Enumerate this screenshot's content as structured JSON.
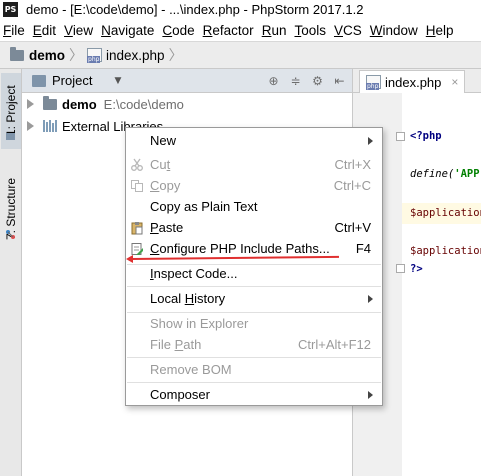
{
  "window": {
    "title": "demo - [E:\\code\\demo] - ...\\index.php - PhpStorm 2017.1.2",
    "logo_text": "PS"
  },
  "menubar": {
    "items": [
      {
        "ul": "F",
        "rest": "ile"
      },
      {
        "ul": "E",
        "rest": "dit"
      },
      {
        "ul": "V",
        "rest": "iew"
      },
      {
        "ul": "N",
        "rest": "avigate"
      },
      {
        "ul": "C",
        "rest": "ode"
      },
      {
        "ul": "R",
        "rest": "efactor"
      },
      {
        "ul": "R",
        "rest": "un"
      },
      {
        "ul": "T",
        "rest": "ools"
      },
      {
        "ul": "V",
        "rest": "CS"
      },
      {
        "ul": "W",
        "rest": "indow"
      },
      {
        "ul": "H",
        "rest": "elp"
      }
    ]
  },
  "navbar": {
    "project": "demo",
    "file": "index.php"
  },
  "toolstrip": {
    "project_tab": "1: Project",
    "structure_tab": "7: Structure"
  },
  "project_panel": {
    "title": "Project",
    "tree": [
      {
        "name": "demo",
        "path": "E:\\code\\demo"
      },
      {
        "name": "External Libraries"
      }
    ]
  },
  "editor": {
    "tab_label": "index.php",
    "close_glyph": "×",
    "lines": [
      {
        "text": "<?php"
      },
      {
        "func": "define(",
        "str": "'APP'"
      },
      {
        "var": "$application"
      },
      {
        "var": "$application"
      },
      {
        "text": "?>"
      }
    ]
  },
  "context_menu": {
    "items": [
      {
        "label_ul": "",
        "label_pre": "New",
        "label_rest": "",
        "shortcut": "",
        "submenu": true,
        "enabled": true
      },
      {
        "label_pre": "Cu",
        "label_ul": "t",
        "label_rest": "",
        "shortcut": "Ctrl+X",
        "enabled": false
      },
      {
        "label_pre": "",
        "label_ul": "C",
        "label_rest": "opy",
        "shortcut": "Ctrl+C",
        "enabled": false
      },
      {
        "label_pre": "Copy as Plain Text",
        "label_ul": "",
        "label_rest": "",
        "shortcut": "",
        "enabled": true
      },
      {
        "label_pre": "",
        "label_ul": "P",
        "label_rest": "aste",
        "shortcut": "Ctrl+V",
        "enabled": true
      },
      {
        "label_pre": "",
        "label_ul": "C",
        "label_rest": "onfigure PHP Include Paths...",
        "shortcut": "F4",
        "enabled": true
      },
      {
        "label_pre": "",
        "label_ul": "I",
        "label_rest": "nspect Code...",
        "shortcut": "",
        "enabled": true
      },
      {
        "label_pre": "Local ",
        "label_ul": "H",
        "label_rest": "istory",
        "shortcut": "",
        "submenu": true,
        "enabled": true
      },
      {
        "label_pre": "Show in Explorer",
        "label_ul": "",
        "label_rest": "",
        "shortcut": "",
        "enabled": false
      },
      {
        "label_pre": "File ",
        "label_ul": "P",
        "label_rest": "ath",
        "shortcut": "Ctrl+Alt+F12",
        "enabled": false
      },
      {
        "label_pre": "Remove BOM",
        "label_ul": "",
        "label_rest": "",
        "shortcut": "",
        "enabled": false
      },
      {
        "label_pre": "Composer",
        "label_ul": "",
        "label_rest": "",
        "shortcut": "",
        "submenu": true,
        "enabled": true
      }
    ]
  },
  "colors": {
    "annotation_red": "#e03030",
    "disabled_text": "#9a9a9a",
    "panel_header": "#dfe4ea"
  }
}
